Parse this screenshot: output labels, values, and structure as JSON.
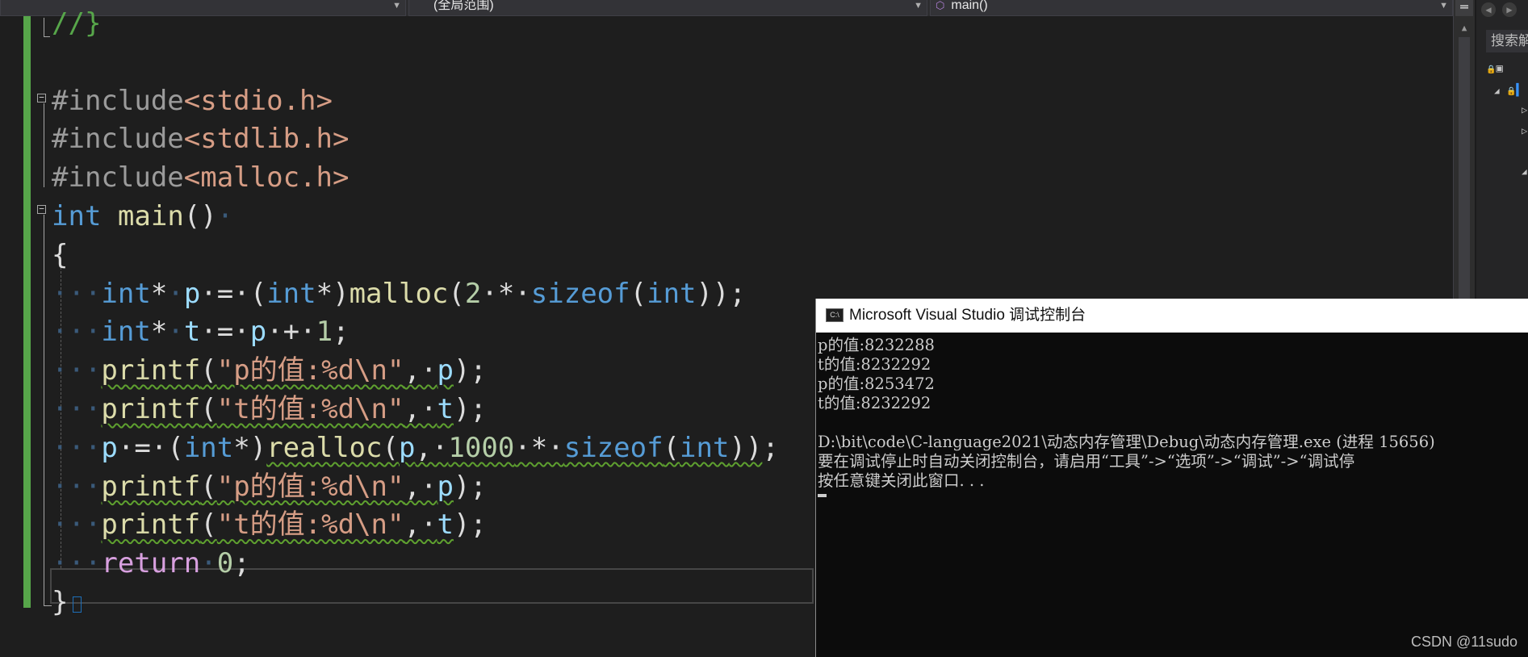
{
  "navbar": {
    "scope_dropdown": "(全局范围)",
    "member_dropdown": "main()"
  },
  "editor": {
    "lines": [
      {
        "parts": [
          {
            "t": "//}",
            "c": "cmt"
          }
        ]
      },
      {
        "parts": []
      },
      {
        "parts": [
          {
            "t": "#include",
            "c": "pp"
          },
          {
            "t": "<stdio.h>",
            "c": "inc"
          }
        ]
      },
      {
        "parts": [
          {
            "t": "#include",
            "c": "pp"
          },
          {
            "t": "<stdlib.h>",
            "c": "inc"
          }
        ]
      },
      {
        "parts": [
          {
            "t": "#include",
            "c": "pp"
          },
          {
            "t": "<malloc.h>",
            "c": "inc"
          }
        ]
      },
      {
        "parts": [
          {
            "t": "int",
            "c": "kw"
          },
          {
            "t": " ",
            "c": ""
          },
          {
            "t": "main",
            "c": "fn"
          },
          {
            "t": "()",
            "c": ""
          },
          {
            "t": "·",
            "c": "dots"
          }
        ]
      },
      {
        "parts": [
          {
            "t": "{",
            "c": ""
          }
        ]
      },
      {
        "parts": [
          {
            "t": "···",
            "c": "dots"
          },
          {
            "t": "int",
            "c": "kw"
          },
          {
            "t": "*",
            "c": ""
          },
          {
            "t": "·",
            "c": "dots"
          },
          {
            "t": "p",
            "c": "var"
          },
          {
            "t": "·=·",
            "c": ""
          },
          {
            "t": "(",
            "c": ""
          },
          {
            "t": "int",
            "c": "kw"
          },
          {
            "t": "*)",
            "c": ""
          },
          {
            "t": "malloc",
            "c": "fn"
          },
          {
            "t": "(",
            "c": ""
          },
          {
            "t": "2",
            "c": "num"
          },
          {
            "t": "·*·",
            "c": ""
          },
          {
            "t": "sizeof",
            "c": "kw"
          },
          {
            "t": "(",
            "c": ""
          },
          {
            "t": "int",
            "c": "kw"
          },
          {
            "t": "));",
            "c": ""
          }
        ]
      },
      {
        "parts": [
          {
            "t": "···",
            "c": "dots"
          },
          {
            "t": "int",
            "c": "kw"
          },
          {
            "t": "*",
            "c": ""
          },
          {
            "t": "·",
            "c": "dots"
          },
          {
            "t": "t",
            "c": "var"
          },
          {
            "t": "·=·",
            "c": ""
          },
          {
            "t": "p",
            "c": "var"
          },
          {
            "t": "·+·",
            "c": ""
          },
          {
            "t": "1",
            "c": "num"
          },
          {
            "t": ";",
            "c": ""
          }
        ]
      },
      {
        "parts": [
          {
            "t": "···",
            "c": "dots"
          },
          {
            "t": "printf",
            "c": "fn",
            "sq": 1
          },
          {
            "t": "(",
            "c": "",
            "sq": 1
          },
          {
            "t": "\"p的值:%d\\n\"",
            "c": "str",
            "sq": 1
          },
          {
            "t": ",·",
            "c": "",
            "sq": 1
          },
          {
            "t": "p",
            "c": "var",
            "sq": 1
          },
          {
            "t": ");",
            "c": ""
          }
        ]
      },
      {
        "parts": [
          {
            "t": "···",
            "c": "dots"
          },
          {
            "t": "printf",
            "c": "fn",
            "sq": 1
          },
          {
            "t": "(",
            "c": "",
            "sq": 1
          },
          {
            "t": "\"t的值:%d\\n\"",
            "c": "str",
            "sq": 1
          },
          {
            "t": ",·",
            "c": "",
            "sq": 1
          },
          {
            "t": "t",
            "c": "var",
            "sq": 1
          },
          {
            "t": ");",
            "c": ""
          }
        ]
      },
      {
        "parts": [
          {
            "t": "···",
            "c": "dots"
          },
          {
            "t": "p",
            "c": "var"
          },
          {
            "t": "·=·",
            "c": ""
          },
          {
            "t": "(",
            "c": ""
          },
          {
            "t": "int",
            "c": "kw"
          },
          {
            "t": "*)",
            "c": ""
          },
          {
            "t": "realloc",
            "c": "fn",
            "sq": 1
          },
          {
            "t": "(",
            "c": "",
            "sq": 1
          },
          {
            "t": "p",
            "c": "var",
            "sq": 1
          },
          {
            "t": ",·",
            "c": "",
            "sq": 1
          },
          {
            "t": "1000",
            "c": "num",
            "sq": 1
          },
          {
            "t": "·*·",
            "c": "",
            "sq": 1
          },
          {
            "t": "sizeof",
            "c": "kw",
            "sq": 1
          },
          {
            "t": "(",
            "c": "",
            "sq": 1
          },
          {
            "t": "int",
            "c": "kw",
            "sq": 1
          },
          {
            "t": "))",
            "c": "",
            "sq": 1
          },
          {
            "t": ";",
            "c": ""
          }
        ]
      },
      {
        "parts": [
          {
            "t": "···",
            "c": "dots"
          },
          {
            "t": "printf",
            "c": "fn",
            "sq": 1
          },
          {
            "t": "(",
            "c": "",
            "sq": 1
          },
          {
            "t": "\"p的值:%d\\n\"",
            "c": "str",
            "sq": 1
          },
          {
            "t": ",·",
            "c": "",
            "sq": 1
          },
          {
            "t": "p",
            "c": "var",
            "sq": 1
          },
          {
            "t": ");",
            "c": ""
          }
        ]
      },
      {
        "parts": [
          {
            "t": "···",
            "c": "dots"
          },
          {
            "t": "printf",
            "c": "fn",
            "sq": 1
          },
          {
            "t": "(",
            "c": "",
            "sq": 1
          },
          {
            "t": "\"t的值:%d\\n\"",
            "c": "str",
            "sq": 1
          },
          {
            "t": ",·",
            "c": "",
            "sq": 1
          },
          {
            "t": "t",
            "c": "var",
            "sq": 1
          },
          {
            "t": ");",
            "c": ""
          }
        ]
      },
      {
        "parts": [
          {
            "t": "···",
            "c": "dots"
          },
          {
            "t": "return",
            "c": "kw2"
          },
          {
            "t": "·",
            "c": "dots"
          },
          {
            "t": "0",
            "c": "num"
          },
          {
            "t": ";",
            "c": ""
          }
        ]
      },
      {
        "parts": [
          {
            "t": "}",
            "c": ""
          }
        ],
        "caret": true
      }
    ]
  },
  "solution_explorer": {
    "search_placeholder": "搜索解"
  },
  "console": {
    "title": "Microsoft Visual Studio 调试控制台",
    "output_lines": [
      "p的值:8232288",
      "t的值:8232292",
      "p的值:8253472",
      "t的值:8232292",
      "",
      "D:\\bit\\code\\C-language2021\\动态内存管理\\Debug\\动态内存管理.exe (进程 15656)",
      "要在调试停止时自动关闭控制台，请启用“工具”->“选项”->“调试”->“调试停",
      "按任意键关闭此窗口. . ."
    ]
  },
  "watermark": "CSDN @11sudo"
}
